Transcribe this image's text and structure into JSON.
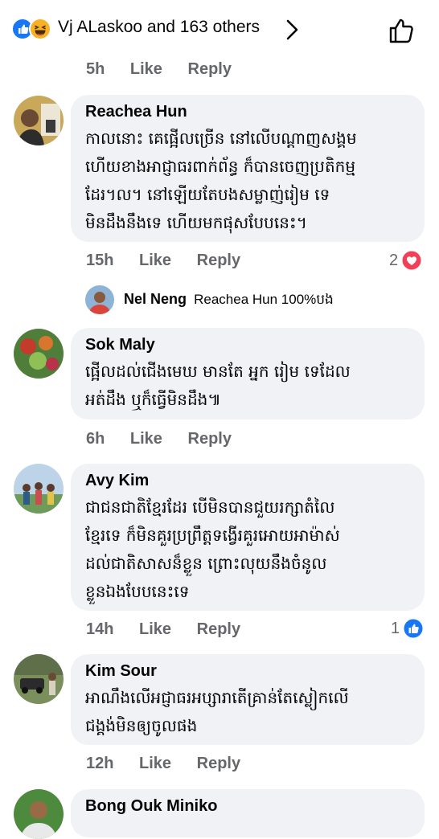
{
  "top": {
    "reactions_summary": "Vj ALaskoo and 163 others",
    "reaction_icons": [
      "like-icon",
      "haha-icon"
    ],
    "action_icon": "thumbs-up-outline-icon"
  },
  "prev_comment": {
    "time": "5h",
    "like": "Like",
    "reply": "Reply"
  },
  "comments": [
    {
      "author": "Reachea Hun",
      "lines": [
        "កាលនោះ គេផ្អើលច្រើន នៅលើបណ្ដាញសង្គម",
        "ហើយខាងអាជ្ញាធរពាក់ព័ន្ធ ក៏បានចេញប្រតិកម្ម",
        "ដែរ។ល។ នៅឡើយតែបងសម្លាញ់រៀម ទេ",
        "មិនដឹងនឹងទេ ហើយមកផុសបែបនេះ។"
      ],
      "time": "15h",
      "like": "Like",
      "reply": "Reply",
      "reaction_count": "2",
      "reaction_icon": "love-icon"
    },
    {
      "author": "Sok Maly",
      "lines": [
        "ផ្អើលដល់ជើងមេឃ មានតែ អ្នក រៀម ទេដែល",
        "អត់ដឹង ឬក៏ធ្វើមិនដឹង៕"
      ],
      "time": "6h",
      "like": "Like",
      "reply": "Reply"
    },
    {
      "author": "Avy Kim",
      "lines": [
        "ជាជនជាតិខ្មែរដែរ បើមិនបានជួយរក្សាតំលៃ",
        "ខ្មែរទេ ក៏មិនគួរប្រព្រឹត្តទង្វើរគួរអោយអាម៉ាស់",
        "ដល់ជាតិសាសន៏ខ្លួន ព្រោះលុយនឹងចំនូល",
        "ខ្លួនឯងបែបនេះទេ"
      ],
      "time": "14h",
      "like": "Like",
      "reply": "Reply",
      "reaction_count": "1",
      "reaction_icon": "like-icon"
    },
    {
      "author": "Kim Sour",
      "lines": [
        "អាណឹងលើអជ្ញាធរអប្សារាតើគ្រាន់តែស្លៀកលើ",
        "ជង្គង់មិនឲ្យចូលផង"
      ],
      "time": "12h",
      "like": "Like",
      "reply": "Reply"
    },
    {
      "author": "Bong Ouk Miniko"
    }
  ],
  "reply_preview": {
    "name": "Nel Neng",
    "text": "Reachea Hun 100%បង"
  },
  "colors": {
    "accent": "#1877f2",
    "love": "#f33e58",
    "meta": "#65676b",
    "bubble": "#f0f2f5"
  }
}
